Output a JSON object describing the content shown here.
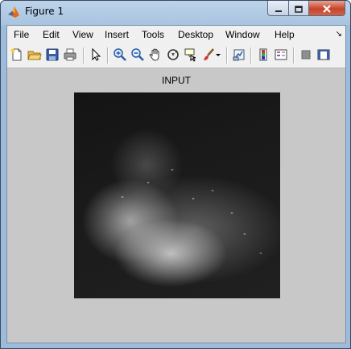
{
  "window": {
    "title": "Figure 1",
    "controls": {
      "minimize": "minimize-icon",
      "maximize": "maximize-icon",
      "close": "close-icon"
    }
  },
  "menubar": {
    "items": [
      "File",
      "Edit",
      "View",
      "Insert",
      "Tools",
      "Desktop",
      "Window",
      "Help"
    ],
    "overflow_arrow": "↘"
  },
  "toolbar": {
    "buttons": [
      "new-figure-icon",
      "open-file-icon",
      "save-icon",
      "print-icon",
      "edit-plot-icon",
      "zoom-in-icon",
      "zoom-out-icon",
      "pan-icon",
      "rotate-3d-icon",
      "data-cursor-icon",
      "brush-icon",
      "brush-dropdown-icon",
      "link-plot-icon",
      "insert-colorbar-icon",
      "insert-legend-icon",
      "hide-plot-tools-icon",
      "show-plot-tools-icon"
    ]
  },
  "axes": {
    "title": "INPUT"
  },
  "colors": {
    "figure_background": "#c8c8c8",
    "menubar_background": "#f0f0f0",
    "titlebar": "#a9c4e0",
    "close_button": "#c7452c"
  }
}
